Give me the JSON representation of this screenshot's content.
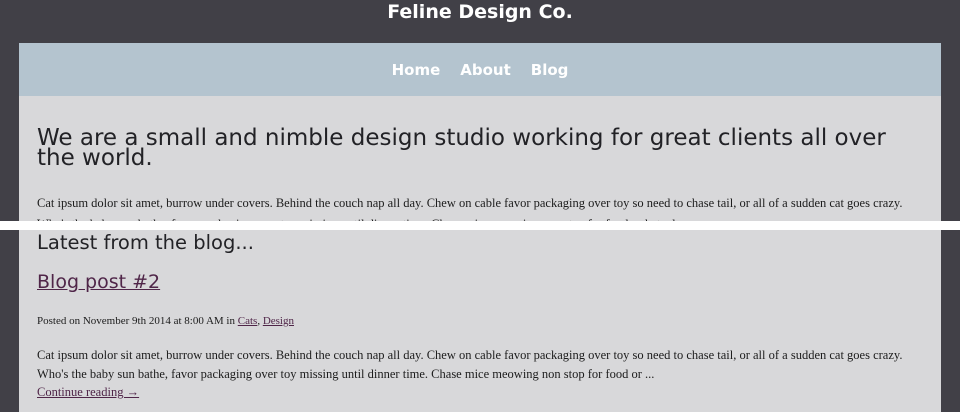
{
  "site": {
    "title": "Feline Design Co."
  },
  "nav": {
    "items": [
      {
        "label": "Home"
      },
      {
        "label": "About"
      },
      {
        "label": "Blog"
      }
    ]
  },
  "hero": {
    "headline": "We are a small and nimble design studio working for great clients all over the world.",
    "intro": "Cat ipsum dolor sit amet, burrow under covers. Behind the couch nap all day. Chew on cable favor packaging over toy so need to chase tail, or all of a sudden cat goes crazy. Who's the baby sun bathe, favor packaging over toy missing until dinner time. Chase mice meowing non stop for food or hate dog"
  },
  "blog": {
    "section_title": "Latest from the blog...",
    "post": {
      "title": "Blog post #2",
      "posted_on": "Posted on November 9th 2014 at 8:00 AM in",
      "categories": [
        "Cats",
        "Design"
      ],
      "excerpt": "Cat ipsum dolor sit amet, burrow under covers. Behind the couch nap all day. Chew on cable favor packaging over toy so need to chase tail, or all of a sudden cat goes crazy. Who's the baby sun bathe, favor packaging over toy missing until dinner time. Chase mice meowing non stop for food or ...",
      "continue_label": "Continue reading →"
    }
  },
  "colors": {
    "background": "#414047",
    "nav_bar": "#b4c4cf",
    "panel": "#d8d8da",
    "link": "#4f2548"
  }
}
